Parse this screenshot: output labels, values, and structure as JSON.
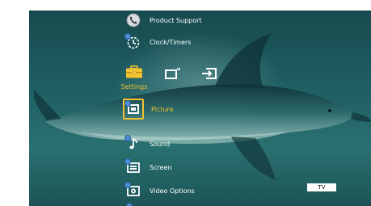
{
  "home_menu": {
    "categories": {
      "settings_label": "Settings",
      "settings_icon": "toolbox-icon",
      "external_inputs_icon": "external-inputs-icon",
      "input_icon": "input-icon"
    },
    "items": [
      {
        "label": "Product Support",
        "icon": "phone-icon",
        "selected": false
      },
      {
        "label": "Clock/Timers",
        "icon": "clock-icon",
        "selected": false
      },
      {
        "label": "Picture",
        "icon": "picture-icon",
        "selected": true
      },
      {
        "label": "Sound",
        "icon": "music-note-icon",
        "selected": false
      },
      {
        "label": "Screen",
        "icon": "screen-icon",
        "selected": false
      },
      {
        "label": "Video Options",
        "icon": "video-options-icon",
        "selected": false
      }
    ]
  },
  "input_badge": "TV",
  "colors": {
    "accent": "#f2c230",
    "text": "#ffffff",
    "background": "#1f5f63"
  }
}
